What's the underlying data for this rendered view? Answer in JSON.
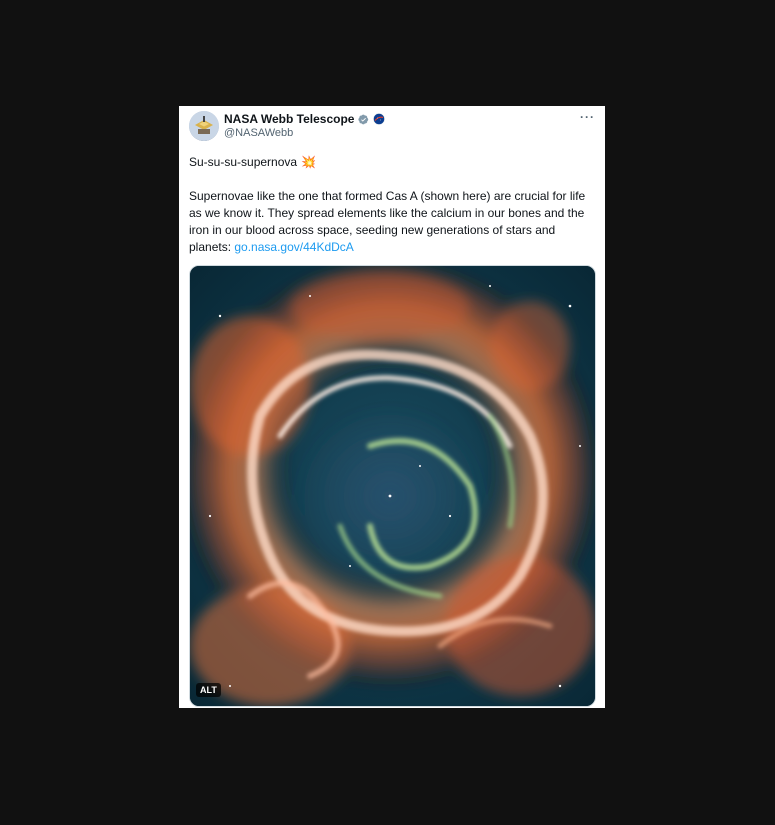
{
  "tweet": {
    "display_name": "NASA Webb Telescope",
    "handle": "@NASAWebb",
    "more_label": "···",
    "line1": "Su-su-su-supernova",
    "line1_emoji": "💥",
    "body": "Supernovae like the one that formed Cas A (shown here) are crucial for life as we know it. They spread elements like the calcium in our bones and the iron in our blood across space, seeding new generations of stars and planets: ",
    "link_text": "go.nasa.gov/44KdDcA",
    "media": {
      "alt_badge": "ALT",
      "subject_icon": "supernova-remnant-image"
    }
  },
  "colors": {
    "page_bg": "#111111",
    "card_bg": "#ffffff",
    "link": "#1d9bf0",
    "verified": "#829aab",
    "text": "#0f1419",
    "muted": "#536471"
  }
}
